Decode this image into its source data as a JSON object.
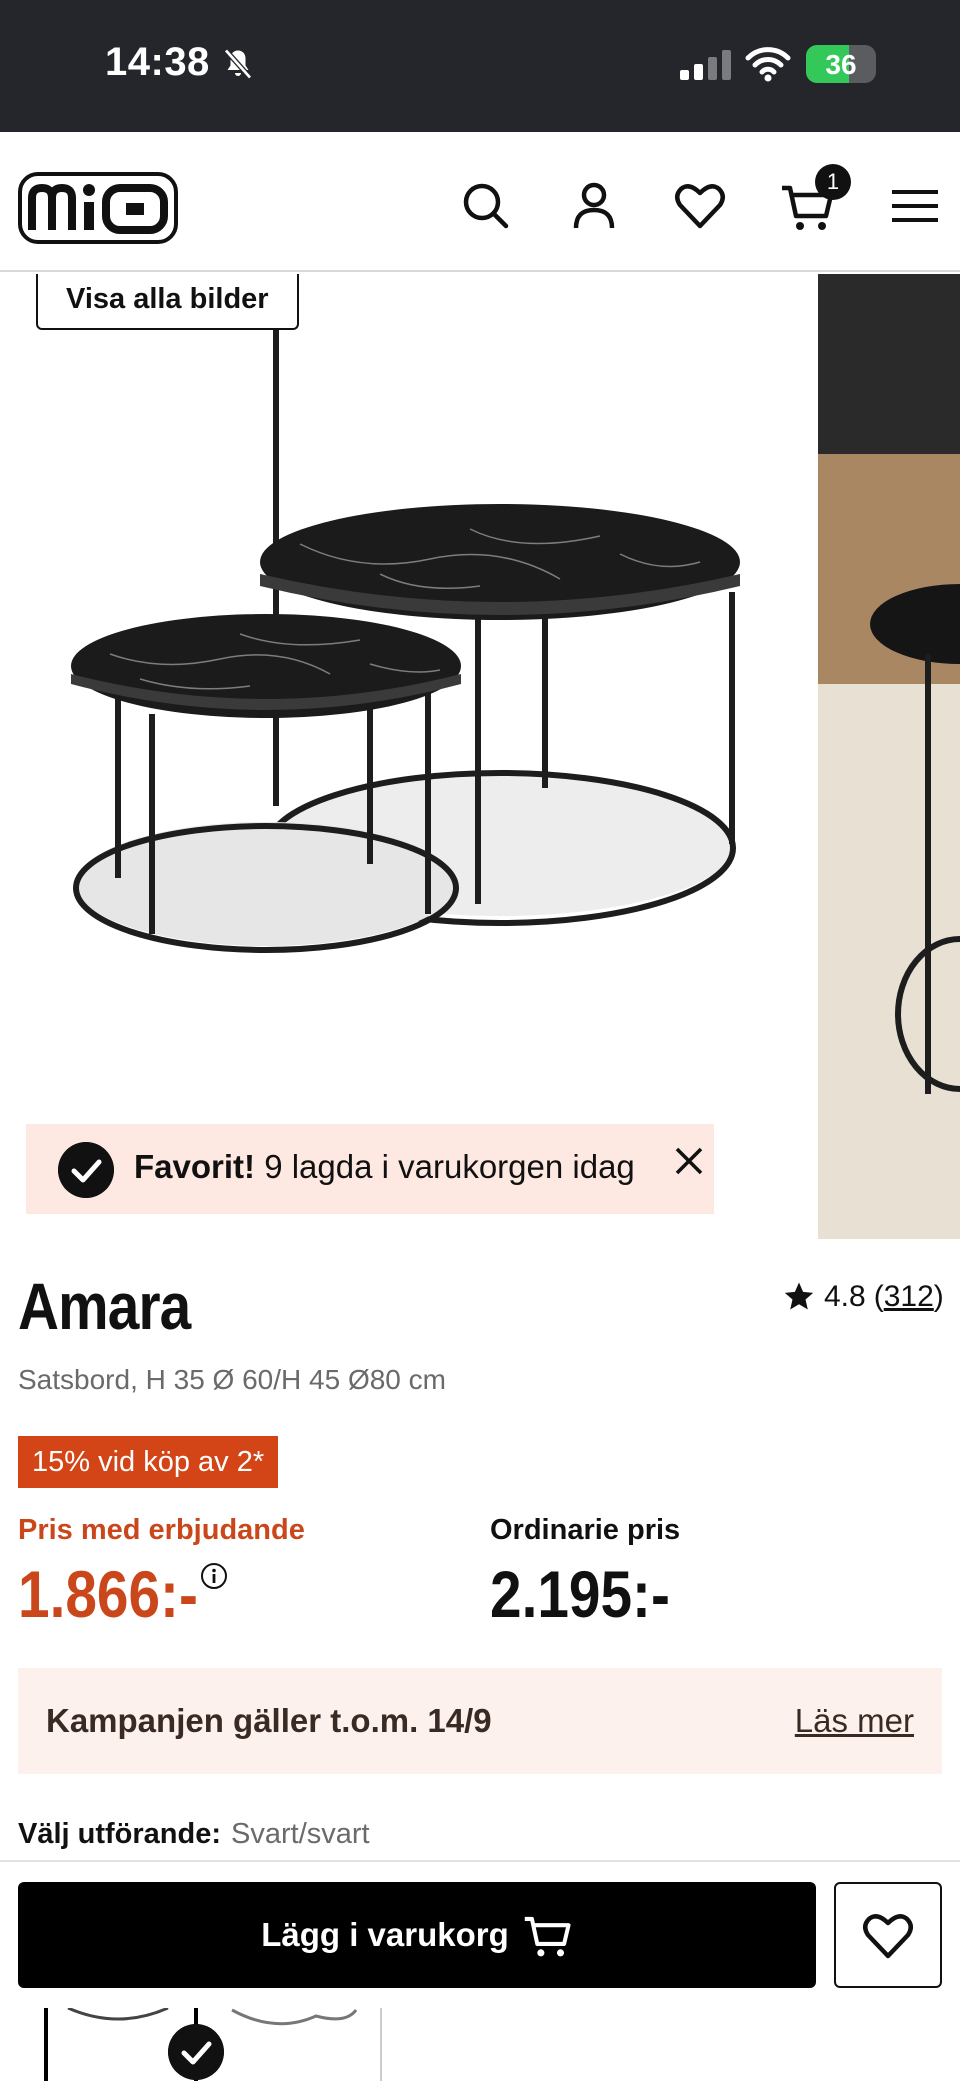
{
  "status_bar": {
    "time": "14:38",
    "battery": "36"
  },
  "header": {
    "brand": "mio",
    "cart_count": "1"
  },
  "gallery": {
    "show_all_label": "Visa alla bilder",
    "banner_bold": "Favorit!",
    "banner_text": "9 lagda i varukorgen idag"
  },
  "product": {
    "name": "Amara",
    "rating": "4.8",
    "review_count": "312",
    "description": "Satsbord, H 35 Ø 60/H 45 Ø80 cm",
    "promo_badge": "15% vid köp av 2*",
    "offer_label": "Pris med erbjudande",
    "offer_price": "1.866:-",
    "regular_label": "Ordinarie pris",
    "regular_price": "2.195:-"
  },
  "campaign": {
    "text": "Kampanjen gäller t.o.m. 14/9",
    "link": "Läs mer"
  },
  "variant": {
    "label": "Välj utförande:",
    "value": "Svart/svart"
  },
  "actions": {
    "add_to_cart": "Lägg i varukorg"
  },
  "colors": {
    "accent": "#d34416",
    "offer_text": "#c9471a",
    "banner_bg": "#fde8e2",
    "campaign_bg": "#fdf1ee"
  }
}
